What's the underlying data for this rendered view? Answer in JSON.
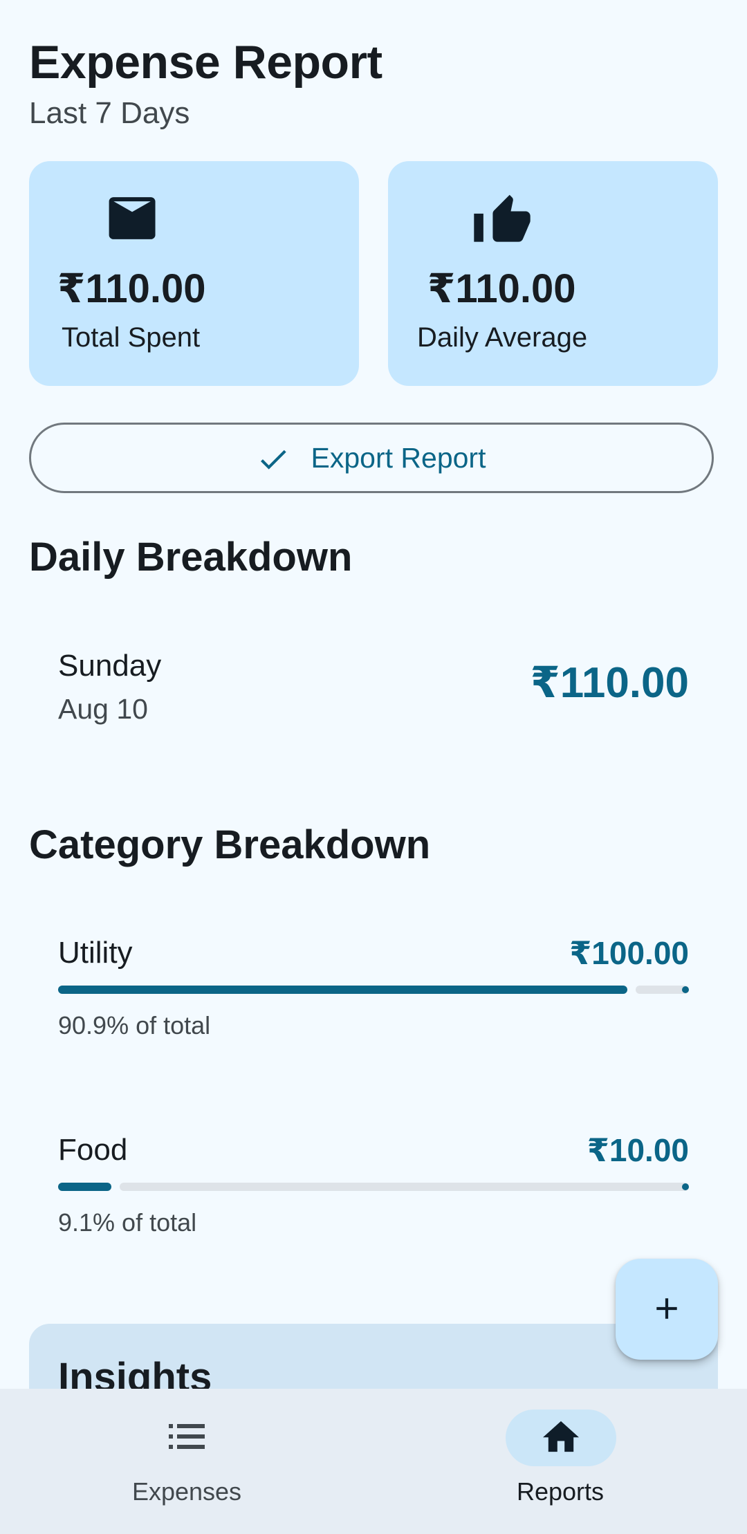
{
  "header": {
    "title": "Expense Report",
    "subtitle": "Last 7 Days"
  },
  "summary": {
    "total": {
      "icon": "mail-icon",
      "amount": "₹110.00",
      "label": "Total Spent"
    },
    "average": {
      "icon": "thumb-up-icon",
      "amount": "₹110.00",
      "label": "Daily Average"
    }
  },
  "export_button": {
    "icon": "check-icon",
    "label": "Export Report"
  },
  "daily": {
    "title": "Daily Breakdown",
    "rows": [
      {
        "day": "Sunday",
        "date": "Aug 10",
        "amount": "₹110.00"
      }
    ]
  },
  "category": {
    "title": "Category Breakdown",
    "rows": [
      {
        "name": "Utility",
        "amount": "₹100.00",
        "share": 0.909,
        "percent_label": "90.9% of total"
      },
      {
        "name": "Food",
        "amount": "₹10.00",
        "share": 0.091,
        "percent_label": "9.1% of total"
      }
    ]
  },
  "insights": {
    "title": "Insights"
  },
  "fab": {
    "icon": "plus-icon"
  },
  "bottom_nav": {
    "items": [
      {
        "label": "Expenses",
        "icon": "list-icon",
        "active": false
      },
      {
        "label": "Reports",
        "icon": "home-icon",
        "active": true
      }
    ]
  },
  "colors": {
    "background": "#f3faff",
    "card": "#c5e7ff",
    "accent": "#0b6587",
    "nav_background": "#e6edf4"
  }
}
